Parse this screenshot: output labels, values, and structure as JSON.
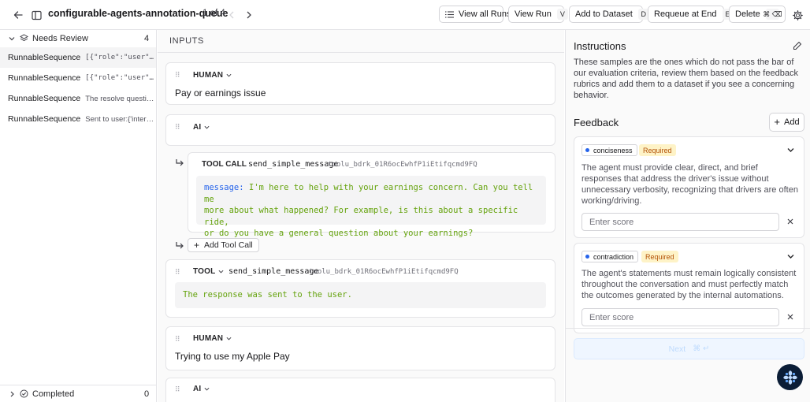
{
  "topbar": {
    "title": "configurable-agents-annotation-queue",
    "pager": "1 of 4",
    "view_all_runs": "View all Runs",
    "view_run": "View Run",
    "view_run_kbd": "V",
    "add_to_dataset": "Add to Dataset",
    "add_to_dataset_kbd": "D",
    "requeue": "Requeue at End",
    "requeue_kbd": "E",
    "delete": "Delete",
    "delete_kbd": "⌘ ⌫"
  },
  "sidebar": {
    "section_label": "Needs Review",
    "section_count": "4",
    "items": [
      {
        "name": "RunnableSequence",
        "preview": "[{\"role\":\"user\",\"id\":\"..."
      },
      {
        "name": "RunnableSequence",
        "preview": "[{\"role\":\"user\",\"id\":\"..."
      },
      {
        "name": "RunnableSequence",
        "preview": "The resolve questio..."
      },
      {
        "name": "RunnableSequence",
        "preview": "Sent to user:{'intera..."
      }
    ],
    "completed_label": "Completed",
    "completed_count": "0"
  },
  "inputs": {
    "header": "INPUTS",
    "messages": [
      {
        "role": "HUMAN",
        "text": "Pay or earnings issue"
      },
      {
        "role": "AI",
        "text": ""
      },
      {
        "role": "HUMAN",
        "text": "Trying to use my Apple Pay"
      },
      {
        "role": "AI",
        "text": ""
      }
    ],
    "tool_call": {
      "label": "TOOL CALL",
      "name": "send_simple_message",
      "id": "toolu_bdrk_01R6ocEwhfP1iEtifqcmd9FQ",
      "key": "message:",
      "line1": " I'm here to help with your earnings concern. Can you tell me",
      "line2": "more about what happened? For example, is this about a specific ride,",
      "line3": "or do you have a general question about your earnings?"
    },
    "add_tool_call": "Add Tool Call",
    "tool": {
      "role": "TOOL",
      "name": "send_simple_message",
      "id": "toolu_bdrk_01R6ocEwhfP1iEtifqcmd9FQ",
      "output": "The response was sent to the user."
    }
  },
  "instructions": {
    "title": "Instructions",
    "text": "These samples are the ones which do not pass the bar of our evaluation criteria, review them based on the feedback rubrics and add them to a dataset if you see a concerning behavior."
  },
  "feedback": {
    "title": "Feedback",
    "add_label": "Add",
    "items": [
      {
        "key": "conciseness",
        "required": "Required",
        "description": "The agent must provide clear, direct, and brief responses that address the driver's issue without unnecessary verbosity, recognizing that drivers are often working/driving.",
        "placeholder": "Enter score"
      },
      {
        "key": "contradiction",
        "required": "Required",
        "description": "The agent's statements must remain logically consistent throughout the conversation and must perfectly match the outcomes generated by the internal automations.",
        "placeholder": "Enter score"
      }
    ],
    "next_label": "Next",
    "next_kbd": "⌘ ↵"
  }
}
